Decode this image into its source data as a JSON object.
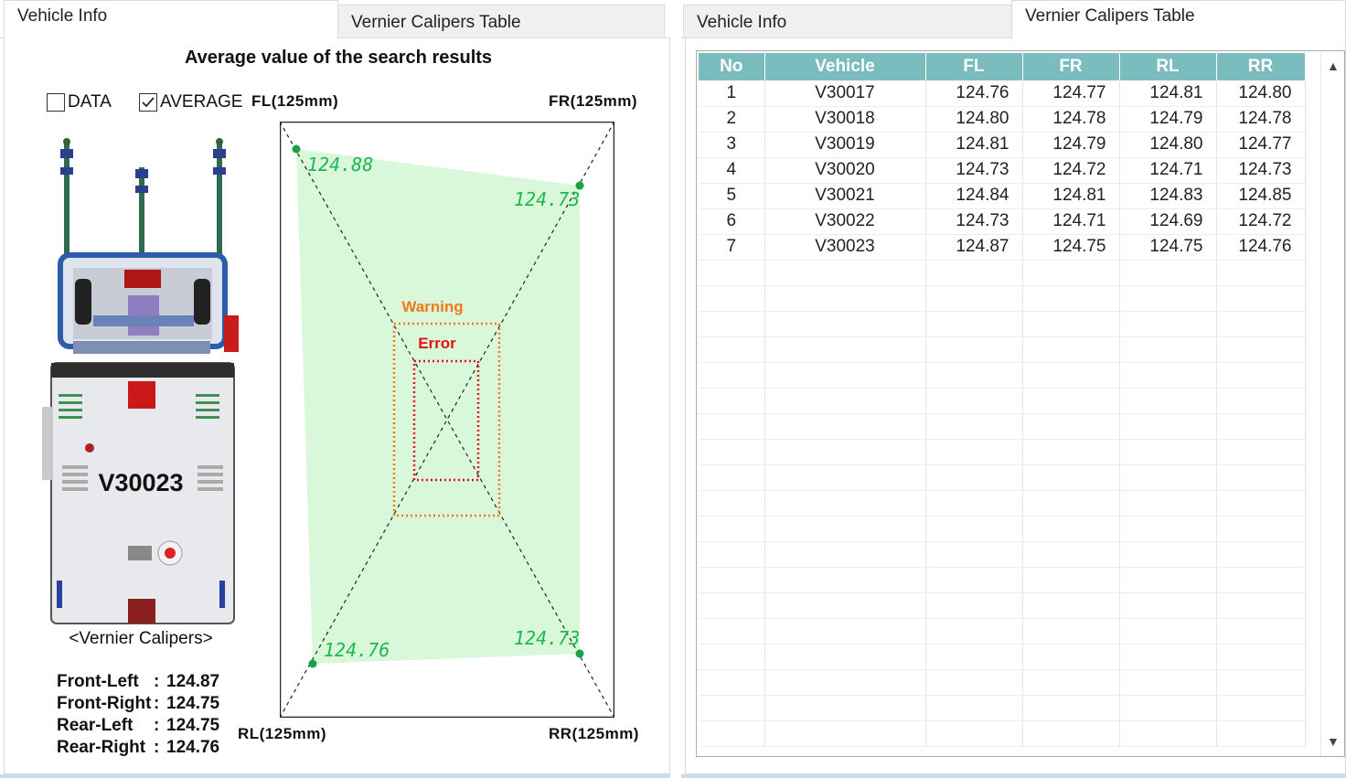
{
  "left_panel": {
    "tabs": [
      {
        "label": "Vehicle Info",
        "active": true
      },
      {
        "label": "Vernier Calipers Table",
        "active": false
      }
    ],
    "title": "Average value of the search results",
    "checkboxes": {
      "data": {
        "label": "DATA",
        "checked": false
      },
      "average": {
        "label": "AVERAGE",
        "checked": true
      }
    },
    "corner_labels": {
      "fl": "FL(125mm)",
      "fr": "FR(125mm)",
      "rl": "RL(125mm)",
      "rr": "RR(125mm)"
    },
    "vehicle_id": "V30023",
    "caption": "<Vernier Calipers>",
    "measurements": [
      {
        "label": "Front-Left",
        "value": "124.87"
      },
      {
        "label": "Front-Right",
        "value": "124.75"
      },
      {
        "label": "Rear-Left",
        "value": "124.75"
      },
      {
        "label": "Rear-Right",
        "value": "124.76"
      }
    ],
    "diagram": {
      "fl_value": "124.88",
      "fr_value": "124.73",
      "rl_value": "124.76",
      "rr_value": "124.73",
      "warning_label": "Warning",
      "error_label": "Error",
      "colors": {
        "fill": "#d9f7d9",
        "point": "#17a34a",
        "value_text": "#1fb84f",
        "warning": "#f07a1a",
        "error": "#e01414"
      }
    }
  },
  "right_panel": {
    "tabs": [
      {
        "label": "Vehicle Info",
        "active": false
      },
      {
        "label": "Vernier Calipers Table",
        "active": true
      }
    ],
    "table": {
      "columns": [
        "No",
        "Vehicle",
        "FL",
        "FR",
        "RL",
        "RR"
      ],
      "rows": [
        [
          "1",
          "V30017",
          "124.76",
          "124.77",
          "124.81",
          "124.80"
        ],
        [
          "2",
          "V30018",
          "124.80",
          "124.78",
          "124.79",
          "124.78"
        ],
        [
          "3",
          "V30019",
          "124.81",
          "124.79",
          "124.80",
          "124.77"
        ],
        [
          "4",
          "V30020",
          "124.73",
          "124.72",
          "124.71",
          "124.73"
        ],
        [
          "5",
          "V30021",
          "124.84",
          "124.81",
          "124.83",
          "124.85"
        ],
        [
          "6",
          "V30022",
          "124.73",
          "124.71",
          "124.69",
          "124.72"
        ],
        [
          "7",
          "V30023",
          "124.87",
          "124.75",
          "124.75",
          "124.76"
        ]
      ],
      "empty_rows": 19,
      "header_color": "#7bbcbf"
    }
  }
}
